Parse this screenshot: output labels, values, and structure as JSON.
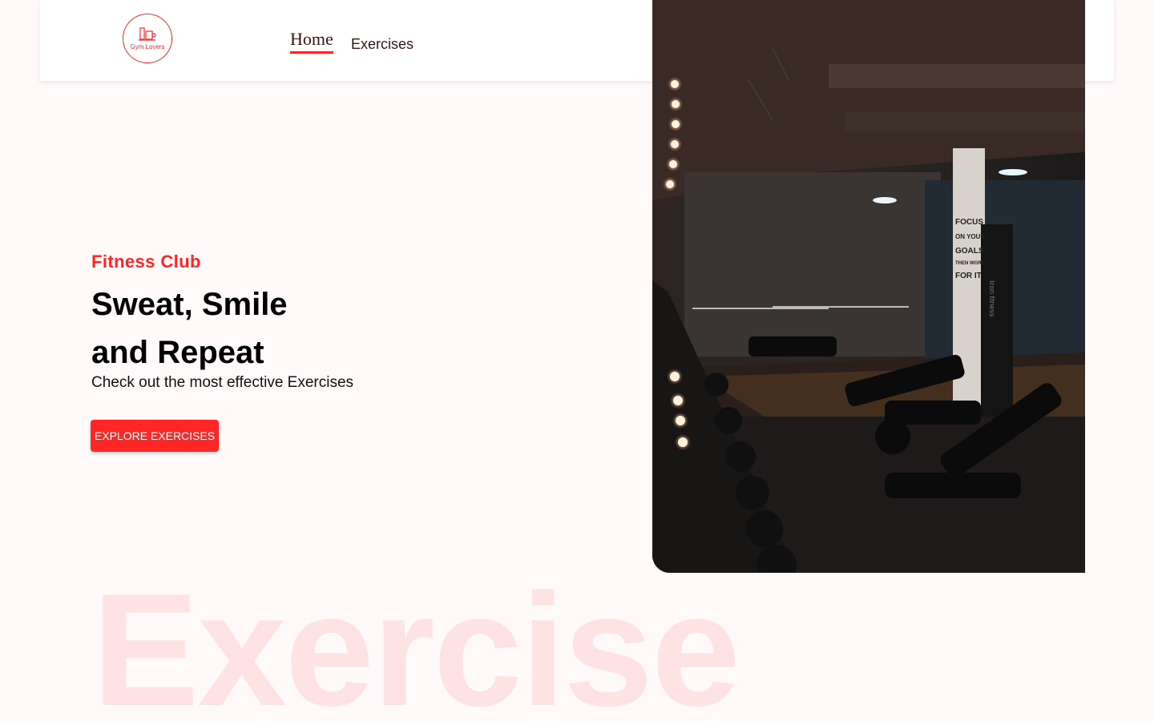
{
  "nav": {
    "logo_text": "Gym Lovers",
    "links": [
      {
        "label": "Home",
        "active": true
      },
      {
        "label": "Exercises",
        "active": false
      }
    ]
  },
  "hero": {
    "subtitle": "Fitness Club",
    "headline_line1": "Sweat, Smile",
    "headline_line2": "and Repeat",
    "description": "Check out the most effective Exercises",
    "cta_label": "EXPLORE EXERCISES",
    "banner_image": "gym-interior-photo",
    "poster_lines": [
      "FOCUS",
      "ON YOUR",
      "GOALS",
      "THEN WORK",
      "FOR IT"
    ],
    "pillar_text": "Icon fitness"
  },
  "watermark": "Exercise",
  "colors": {
    "accent": "#ff2625",
    "background": "#fff9fa",
    "text": "#3a1212"
  }
}
